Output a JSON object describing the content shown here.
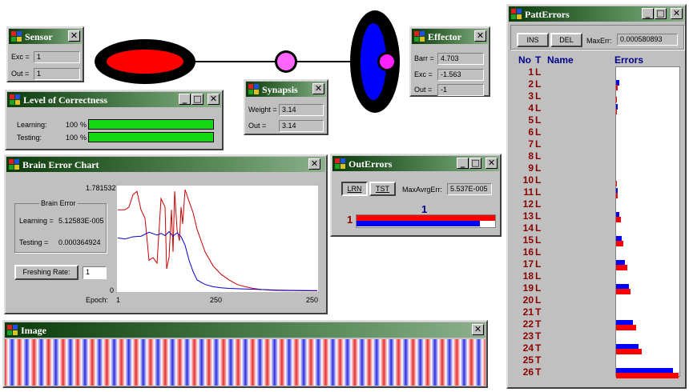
{
  "diagram": {
    "link_color": "#000000",
    "neuron_outer": "#000000",
    "neuron_inner": "#ff0000",
    "synapse_fill": "#ff66ff",
    "effector_inner": "#0000ff"
  },
  "sensor": {
    "title": "Sensor",
    "exc_label": "Exc =",
    "exc_value": "1",
    "out_label": "Out =",
    "out_value": "1"
  },
  "synapsis": {
    "title": "Synapsis",
    "weight_label": "Weight =",
    "weight_value": "3.14",
    "out_label": "Out =",
    "out_value": "3.14"
  },
  "effector": {
    "title": "Effector",
    "barr_label": "Barr =",
    "barr_value": "4.703",
    "exc_label": "Exc =",
    "exc_value": "-1.563",
    "out_label": "Out =",
    "out_value": "-1"
  },
  "correctness": {
    "title": "Level of Correctness",
    "learning_label": "Learning:",
    "learning_value": "100",
    "testing_label": "Testing:",
    "testing_value": "100",
    "unit": "%",
    "learning_level": 1.0,
    "testing_level": 1.0
  },
  "brain_chart": {
    "title": "Brain Error Chart",
    "group_label": "Brain Error",
    "learning_label": "Learning =",
    "learning_value": "5.12583E-005",
    "testing_label": "Testing =",
    "testing_value": "0.000364924",
    "refresh_label": "Freshing Rate:",
    "refresh_value": "1",
    "y_max": "1.781532",
    "y_min": "0",
    "x_axis_label": "Epoch:",
    "x_ticks": [
      "1",
      "250",
      "250"
    ]
  },
  "chart_data": {
    "type": "line",
    "title": "",
    "xlabel": "Epoch:",
    "ylabel": "",
    "xlim": [
      1,
      250
    ],
    "ylim": [
      0,
      1.781532
    ],
    "series": [
      {
        "color": "#cc0000",
        "x": [
          1,
          10,
          15,
          20,
          25,
          30,
          35,
          40,
          45,
          50,
          55,
          60,
          62,
          65,
          68,
          70,
          72,
          75,
          78,
          80,
          82,
          85,
          90,
          95,
          100,
          110,
          120,
          130,
          140,
          150,
          160,
          170,
          180,
          190,
          200,
          220,
          250
        ],
        "y": [
          1.45,
          1.45,
          1.5,
          1.72,
          1.78,
          1.45,
          1.3,
          0.55,
          0.6,
          0.5,
          1.65,
          1.5,
          0.4,
          0.6,
          1.45,
          0.7,
          1.78,
          1.1,
          0.9,
          1.5,
          1.2,
          1.81,
          1.6,
          1.4,
          1.1,
          0.7,
          0.45,
          0.3,
          0.2,
          0.12,
          0.08,
          0.05,
          0.03,
          0.02,
          0.015,
          0.01,
          0.005
        ]
      },
      {
        "color": "#0000cc",
        "x": [
          1,
          10,
          20,
          30,
          40,
          50,
          55,
          60,
          65,
          70,
          75,
          80,
          85,
          90,
          95,
          100,
          110,
          120,
          130,
          140,
          160,
          180,
          200,
          220,
          250
        ],
        "y": [
          0.95,
          0.93,
          0.97,
          0.98,
          1.05,
          1.0,
          1.03,
          0.99,
          1.06,
          0.98,
          1.04,
          0.97,
          0.82,
          0.55,
          0.35,
          0.2,
          0.12,
          0.08,
          0.06,
          0.05,
          0.04,
          0.03,
          0.02,
          0.015,
          0.01
        ]
      }
    ]
  },
  "image_win": {
    "title": "Image",
    "stripe_colors": [
      "#e63030",
      "#ffffff",
      "#2e2ee0",
      "#ffffff"
    ]
  },
  "outerrors": {
    "title": "OutErrors",
    "lrn_label": "LRN",
    "tst_label": "TST",
    "max_label": "MaxAvrgErr:",
    "max_value": "5.537E-005",
    "col_label": "1",
    "row_label": "1",
    "red_level": 1.0,
    "blue_level": 0.89
  },
  "patt": {
    "title": "PattErrors",
    "ins_label": "INS",
    "del_label": "DEL",
    "max_label": "MaxErr:",
    "max_value": "0.000580893",
    "col_no": "No",
    "col_t": "T",
    "col_name": "Name",
    "col_errors": "Errors",
    "rows": [
      {
        "no": "1",
        "t": "L",
        "blue": 0,
        "red": 0
      },
      {
        "no": "2",
        "t": "L",
        "blue": 0.05,
        "red": 0.03
      },
      {
        "no": "3",
        "t": "L",
        "blue": 0,
        "red": 0.01
      },
      {
        "no": "4",
        "t": "L",
        "blue": 0.02,
        "red": 0.01
      },
      {
        "no": "5",
        "t": "L",
        "blue": 0,
        "red": 0
      },
      {
        "no": "6",
        "t": "L",
        "blue": 0,
        "red": 0
      },
      {
        "no": "7",
        "t": "L",
        "blue": 0,
        "red": 0
      },
      {
        "no": "8",
        "t": "L",
        "blue": 0,
        "red": 0
      },
      {
        "no": "9",
        "t": "L",
        "blue": 0,
        "red": 0
      },
      {
        "no": "10",
        "t": "L",
        "blue": 0,
        "red": 0.01
      },
      {
        "no": "11",
        "t": "L",
        "blue": 0.02,
        "red": 0.03
      },
      {
        "no": "12",
        "t": "L",
        "blue": 0,
        "red": 0
      },
      {
        "no": "13",
        "t": "L",
        "blue": 0.05,
        "red": 0.07
      },
      {
        "no": "14",
        "t": "L",
        "blue": 0,
        "red": 0
      },
      {
        "no": "15",
        "t": "L",
        "blue": 0.09,
        "red": 0.12
      },
      {
        "no": "16",
        "t": "L",
        "blue": 0,
        "red": 0
      },
      {
        "no": "17",
        "t": "L",
        "blue": 0.14,
        "red": 0.18
      },
      {
        "no": "18",
        "t": "L",
        "blue": 0,
        "red": 0
      },
      {
        "no": "19",
        "t": "L",
        "blue": 0.2,
        "red": 0.23
      },
      {
        "no": "20",
        "t": "L",
        "blue": 0,
        "red": 0
      },
      {
        "no": "21",
        "t": "T",
        "blue": 0,
        "red": 0
      },
      {
        "no": "22",
        "t": "T",
        "blue": 0.27,
        "red": 0.32
      },
      {
        "no": "23",
        "t": "T",
        "blue": 0,
        "red": 0
      },
      {
        "no": "24",
        "t": "T",
        "blue": 0.35,
        "red": 0.41
      },
      {
        "no": "25",
        "t": "T",
        "blue": 0,
        "red": 0
      },
      {
        "no": "26",
        "t": "T",
        "blue": 0.9,
        "red": 0.99
      }
    ]
  }
}
